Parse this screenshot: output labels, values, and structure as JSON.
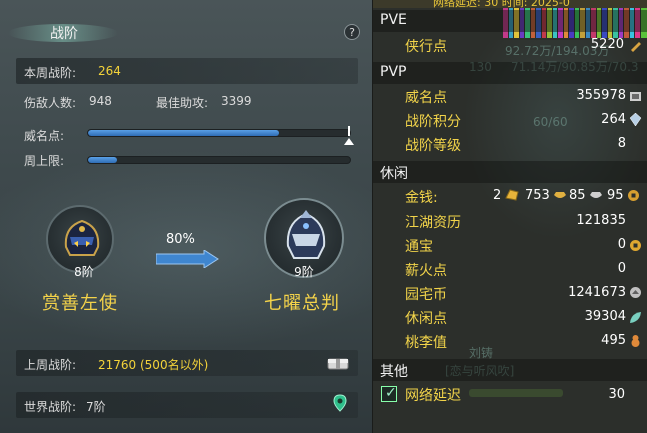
{
  "left_panel": {
    "title": "战阶",
    "help_label": "?",
    "weekly_rank": {
      "label": "本周战阶:",
      "value": "264"
    },
    "kills": {
      "label": "伤敌人数:",
      "value": "948"
    },
    "best_assist": {
      "label": "最佳助攻:",
      "value": "3399"
    },
    "prestige": {
      "label": "威名点:",
      "fill_fraction": 0.73
    },
    "weekly_cap": {
      "label": "周上限:",
      "fill_fraction": 0.11
    },
    "current_rank": {
      "level": "8阶",
      "name": "赏善左使"
    },
    "next_rank": {
      "level": "9阶",
      "name": "七曜总判"
    },
    "progress_percent": "80%",
    "last_week": {
      "label": "上周战阶:",
      "value": "21760 (500名以外)"
    },
    "world_rank": {
      "label": "世界战阶:",
      "value": "7阶"
    }
  },
  "right_panel": {
    "top_strip": "网络延迟: 30 时间: 2025-0",
    "pve": {
      "title": "PVE",
      "items": [
        {
          "name": "侠行点",
          "value": "5220",
          "icon": "brush-icon"
        }
      ]
    },
    "pvp": {
      "title": "PVP",
      "items": [
        {
          "name": "威名点",
          "value": "355978",
          "icon": "banner-icon"
        },
        {
          "name": "战阶积分",
          "value": "264",
          "icon": "crystal-icon"
        },
        {
          "name": "战阶等级",
          "value": "8"
        }
      ]
    },
    "leisure": {
      "title": "休闲",
      "money": {
        "name": "金钱:",
        "gold": "2",
        "silver": "753",
        "copper_a": "85",
        "copper_b": "95"
      },
      "items": [
        {
          "name": "江湖资历",
          "value": "121835"
        },
        {
          "name": "通宝",
          "value": "0",
          "icon": "coin-icon"
        },
        {
          "name": "薪火点",
          "value": "0"
        },
        {
          "name": "园宅币",
          "value": "1241673",
          "icon": "house-coin-icon"
        },
        {
          "name": "休闲点",
          "value": "39304",
          "icon": "leaf-icon"
        },
        {
          "name": "桃李值",
          "value": "495",
          "icon": "gourd-icon"
        }
      ]
    },
    "other": {
      "title": "其他",
      "latency": {
        "name": "网络延迟",
        "value": "30",
        "checked": true
      }
    },
    "overlay": {
      "coords_1": "92.72万/194.03万",
      "coords_2": "71.14万/90.85万/70.3",
      "level_130": "130",
      "hp": "60/60",
      "npc_name": "刘铸",
      "npc_title": "[恋与听风吹]"
    }
  },
  "colors": {
    "accent_yellow": "#f3d33a",
    "bar_blue": "#3f86d0",
    "panel_bg": "#3e494c"
  }
}
